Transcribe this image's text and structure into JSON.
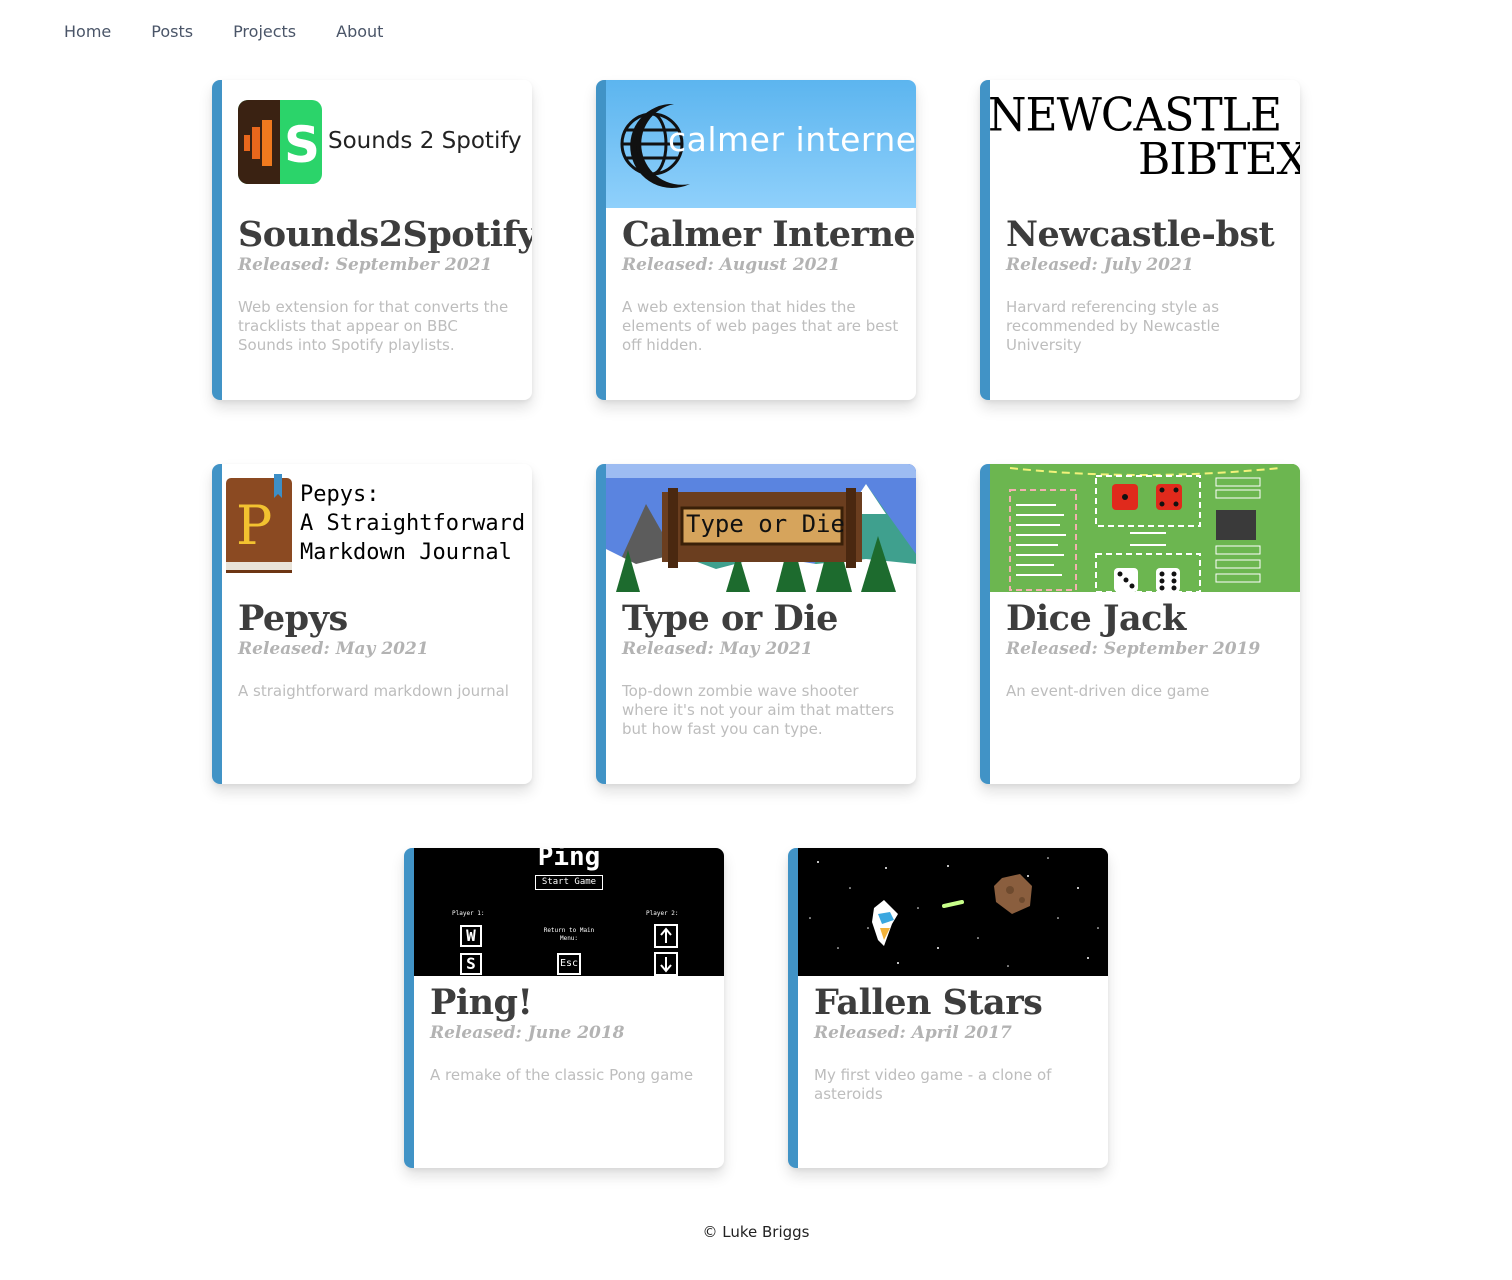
{
  "nav": {
    "home": "Home",
    "posts": "Posts",
    "projects": "Projects",
    "about": "About"
  },
  "colors": {
    "accent_stripe": "#4193c6",
    "title": "#3d3d3d",
    "muted": "#b3b3b3"
  },
  "projects": [
    {
      "title": "Sounds2Spotify",
      "released": "Released: September 2021",
      "description": "Web extension for that converts the tracklists that appear on BBC Sounds into Spotify playlists.",
      "thumb_text": "Sounds 2 Spotify",
      "thumb_icon": "sounds2spotify-logo-icon"
    },
    {
      "title": "Calmer Internet",
      "released": "Released: August 2021",
      "description": "A web extension that hides the elements of web pages that are best off hidden.",
      "thumb_text": "calmer internet",
      "thumb_icon": "crescent-globe-icon"
    },
    {
      "title": "Newcastle-bst",
      "released": "Released: July 2021",
      "description": "Harvard referencing style as recommended by Newcastle University",
      "thumb_line1": "NEWCASTLE",
      "thumb_line2": "BIBTEX"
    },
    {
      "title": "Pepys",
      "released": "Released: May 2021",
      "description": "A straightforward markdown journal",
      "thumb_line1": "Pepys:",
      "thumb_line2": "A Straightforward",
      "thumb_line3": "Markdown Journal",
      "thumb_icon": "book-icon"
    },
    {
      "title": "Type or Die",
      "released": "Released: May 2021",
      "description": "Top-down zombie wave shooter where it's not your aim that matters but how fast you can type.",
      "thumb_text": "Type or Die"
    },
    {
      "title": "Dice Jack",
      "released": "Released: September 2019",
      "description": "An event-driven dice game",
      "thumb_icon": "dice-board-icon"
    },
    {
      "title": "Ping!",
      "released": "Released: June 2018",
      "description": "A remake of the classic Pong game",
      "thumb_title": "Ping",
      "thumb_start": "Start Game",
      "thumb_p1": "Player 1:",
      "thumb_p2": "Player 2:",
      "thumb_menu": "Return to Main Menu:",
      "thumb_w": "W",
      "thumb_s": "S",
      "thumb_esc": "Esc"
    },
    {
      "title": "Fallen Stars",
      "released": "Released: April 2017",
      "description": "My first video game - a clone of asteroids",
      "thumb_icon": "spaceship-icon"
    }
  ],
  "footer": "© Luke Briggs"
}
